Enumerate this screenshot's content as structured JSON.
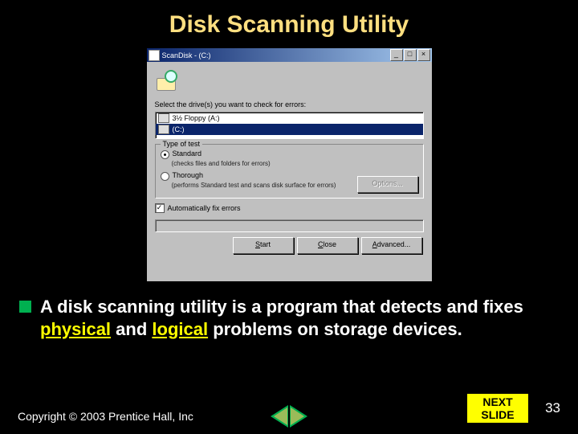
{
  "slide": {
    "title": "Disk Scanning Utility",
    "number": "33",
    "copyright": "Copyright © 2003 Prentice Hall, Inc",
    "next_line1": "NEXT",
    "next_line2": "SLIDE"
  },
  "body": {
    "prefix": "A disk scanning utility is a program that detects and fixes ",
    "hl1": "physical",
    "mid": " and ",
    "hl2": "logical",
    "suffix": " problems on storage devices."
  },
  "dialog": {
    "title": "ScanDisk - (C:)",
    "prompt": "Select the drive(s) you want to check for errors:",
    "drives": [
      {
        "label": "3½ Floppy (A:)"
      },
      {
        "label": "(C:)"
      }
    ],
    "group_label": "Type of test",
    "radio_standard": "Standard",
    "radio_standard_desc": "(checks files and folders for errors)",
    "radio_thorough": "Thorough",
    "radio_thorough_desc": "(performs Standard test and scans disk surface for errors)",
    "options_btn": "Options...",
    "autofix": "Automatically fix errors",
    "btn_start": "Start",
    "btn_close": "Close",
    "btn_advanced": "Advanced..."
  }
}
